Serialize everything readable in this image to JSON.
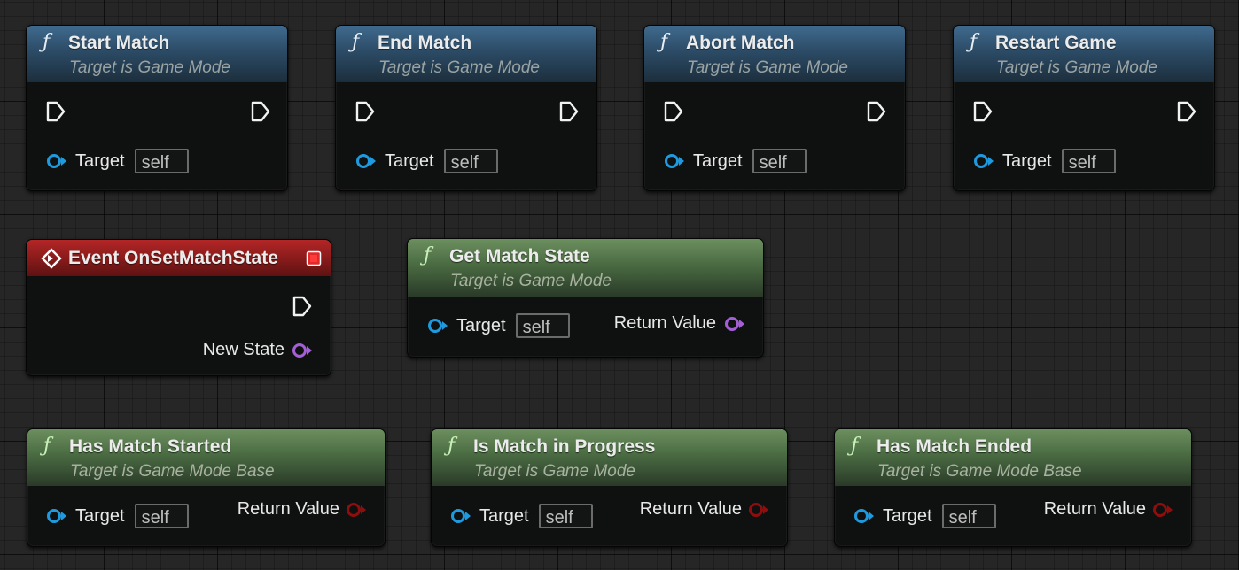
{
  "nodes": {
    "start_match": {
      "title": "Start Match",
      "subtitle": "Target is Game Mode",
      "target_label": "Target",
      "target_value": "self"
    },
    "end_match": {
      "title": "End Match",
      "subtitle": "Target is Game Mode",
      "target_label": "Target",
      "target_value": "self"
    },
    "abort_match": {
      "title": "Abort Match",
      "subtitle": "Target is Game Mode",
      "target_label": "Target",
      "target_value": "self"
    },
    "restart_game": {
      "title": "Restart Game",
      "subtitle": "Target is Game Mode",
      "target_label": "Target",
      "target_value": "self"
    },
    "event_on_set_match_state": {
      "title": "Event OnSetMatchState",
      "output_label": "New State"
    },
    "get_match_state": {
      "title": "Get Match State",
      "subtitle": "Target is Game Mode",
      "target_label": "Target",
      "target_value": "self",
      "return_label": "Return Value"
    },
    "has_match_started": {
      "title": "Has Match Started",
      "subtitle": "Target is Game Mode Base",
      "target_label": "Target",
      "target_value": "self",
      "return_label": "Return Value"
    },
    "is_match_in_progress": {
      "title": "Is Match in Progress",
      "subtitle": "Target is Game Mode",
      "target_label": "Target",
      "target_value": "self",
      "return_label": "Return Value"
    },
    "has_match_ended": {
      "title": "Has Match Ended",
      "subtitle": "Target is Game Mode Base",
      "target_label": "Target",
      "target_value": "self",
      "return_label": "Return Value"
    }
  },
  "icons": {
    "function": "function-icon",
    "event": "event-icon",
    "exec_pin": "exec-pin-icon",
    "object_pin": "object-pin-icon",
    "byte_pin": "byte-pin-icon",
    "bool_pin": "bool-pin-icon",
    "stop": "stop-icon"
  },
  "colors": {
    "function_header": "#3f6a8e",
    "pure_function_header": "#6c8f5f",
    "event_header": "#b32626",
    "object_pin": "#1e9be0",
    "byte_pin": "#a45fd6",
    "bool_pin": "#8e0e0e"
  }
}
